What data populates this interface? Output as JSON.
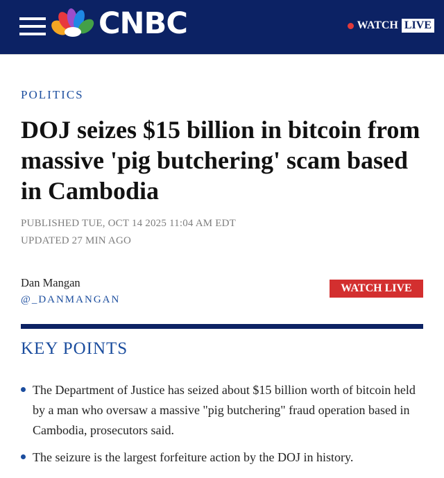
{
  "header": {
    "brand": "CNBC",
    "watch_label": "WATCH",
    "live_label": "LIVE",
    "colors": {
      "bar": "#0c2264",
      "live_dot": "#e23a3a"
    }
  },
  "article": {
    "category": "POLITICS",
    "headline": "DOJ seizes $15 billion in bitcoin from massive 'pig butchering' scam based in Cambodia",
    "published": "PUBLISHED TUE, OCT 14 2025 11:04 AM EDT",
    "updated": "UPDATED 27 MIN AGO",
    "author": "Dan Mangan",
    "author_handle": "@_DANMANGAN",
    "watch_live_button": "WATCH LIVE"
  },
  "key_points": {
    "title": "KEY POINTS",
    "items": [
      "The Department of Justice has seized about $15 billion worth of bitcoin held by a man who oversaw a massive \"pig butchering\" fraud operation based in Cambodia, prosecutors said.",
      "The seizure is the largest forfeiture action by the DOJ in history."
    ]
  }
}
